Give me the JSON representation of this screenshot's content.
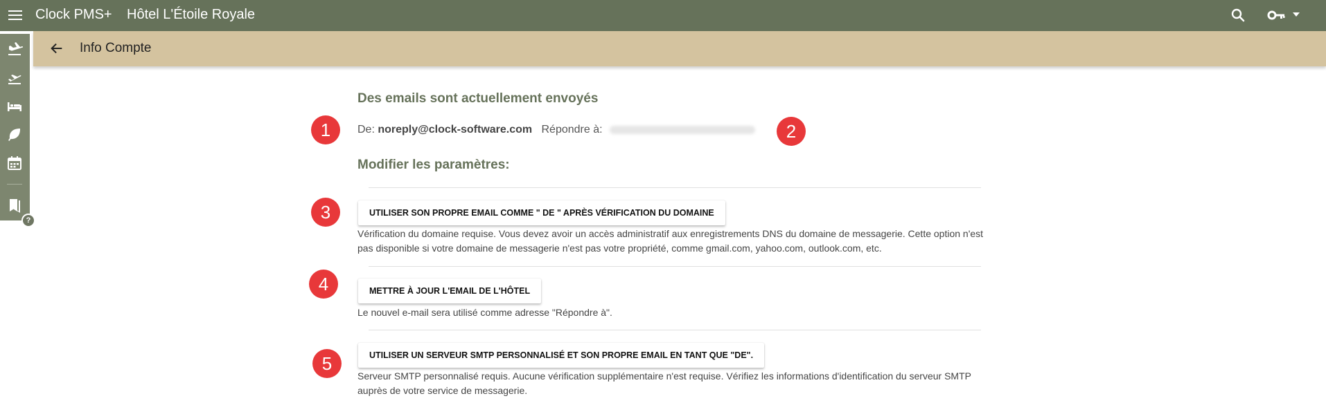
{
  "header": {
    "app_title": "Clock PMS+",
    "hotel_name": "Hôtel L'Étoile Royale",
    "icons": [
      "menu-icon",
      "search-icon",
      "key-icon",
      "caret-down-icon"
    ]
  },
  "subheader": {
    "title": "Info Compte",
    "back_icon": "arrow-left-icon"
  },
  "sidebar": {
    "items": [
      {
        "icon": "airplane-arrival-icon"
      },
      {
        "icon": "airplane-departure-icon"
      },
      {
        "icon": "bed-icon"
      },
      {
        "icon": "leaf-icon"
      },
      {
        "icon": "calendar-icon"
      },
      {
        "icon": "bookmarks-icon"
      }
    ],
    "help": "?"
  },
  "content": {
    "status_heading": "Des emails sont actuellement envoyés",
    "from_label": "De:",
    "from_value": "noreply@clock-software.com",
    "reply_label": "Répondre à:",
    "settings_heading": "Modifier les paramètres:",
    "options": [
      {
        "button": "UTILISER SON PROPRE EMAIL COMME \" DE \" APRÈS VÉRIFICATION DU DOMAINE",
        "description": "Vérification du domaine requise. Vous devez avoir un accès administratif aux enregistrements DNS du domaine de messagerie. Cette option n'est pas disponible si votre domaine de messagerie n'est pas votre propriété, comme gmail.com, yahoo.com, outlook.com, etc."
      },
      {
        "button": "METTRE À JOUR L'EMAIL DE L'HÔTEL",
        "description": "Le nouvel e-mail sera utilisé comme adresse \"Répondre à\"."
      },
      {
        "button": "UTILISER UN SERVEUR SMTP PERSONNALISÉ ET SON PROPRE EMAIL EN TANT QUE \"DE\".",
        "description": "Serveur SMTP personnalisé requis. Aucune vérification supplémentaire n'est requise. Vérifiez les informations d'identification du serveur SMTP auprès de votre service de messagerie."
      }
    ]
  },
  "annotations": [
    "1",
    "2",
    "3",
    "4",
    "5"
  ],
  "colors": {
    "topbar": "#66725a",
    "subheader": "#d4c39f",
    "rail": "#7d866f",
    "heading": "#66725a",
    "badge": "#e8383a"
  }
}
